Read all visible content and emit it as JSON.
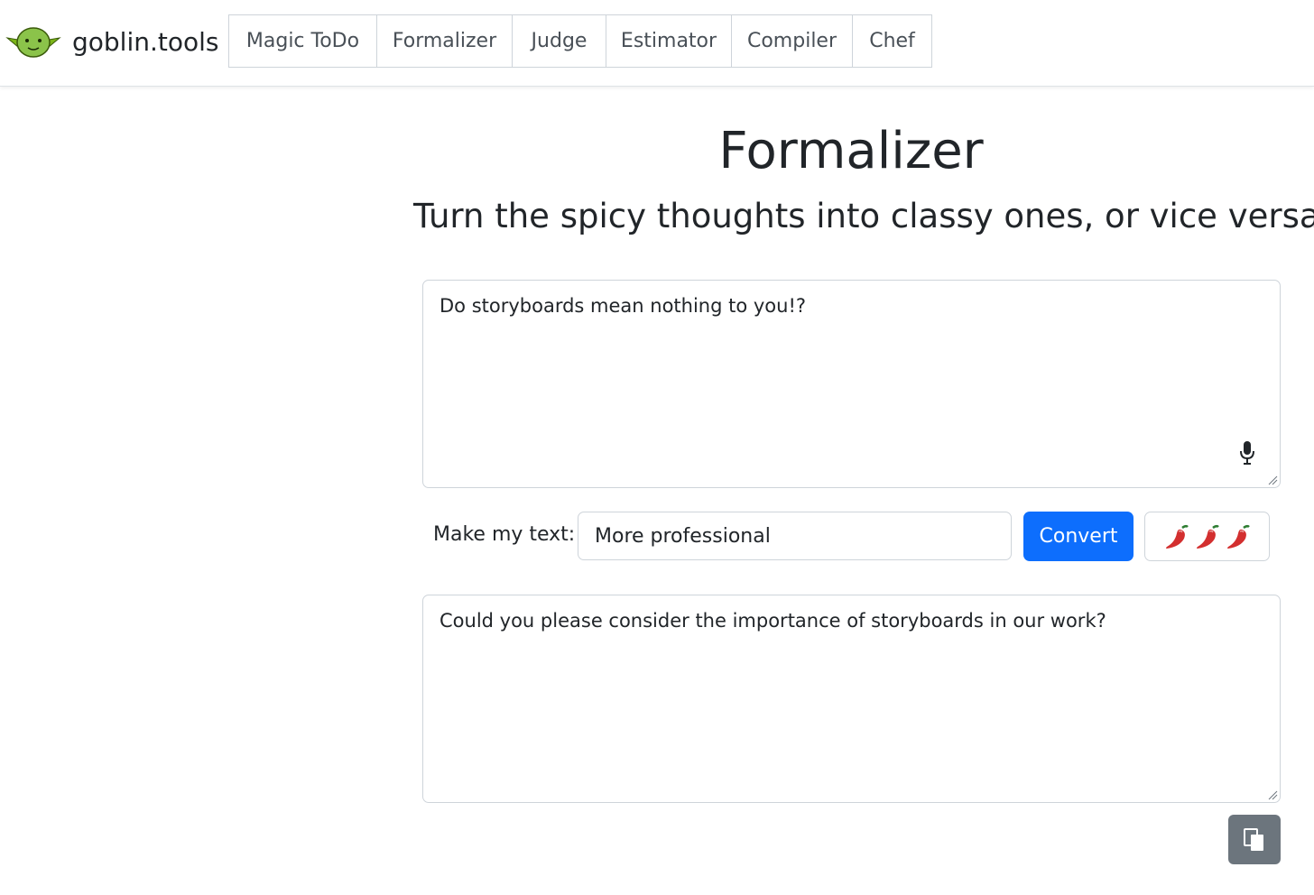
{
  "brand": {
    "name": "goblin.tools",
    "logo_icon": "goblin-face-icon"
  },
  "nav": {
    "items": [
      {
        "label": "Magic ToDo"
      },
      {
        "label": "Formalizer"
      },
      {
        "label": "Judge"
      },
      {
        "label": "Estimator"
      },
      {
        "label": "Compiler"
      },
      {
        "label": "Chef"
      }
    ]
  },
  "main": {
    "title": "Formalizer",
    "subtitle": "Turn the spicy thoughts into classy ones, or vice versa",
    "input_text": "Do storyboards mean nothing to you!?",
    "make_label": "Make my text:",
    "style_selected": "More professional",
    "convert_label": "Convert",
    "spiciness_icon": "chili-pepper-icon",
    "spiciness_level": 3,
    "output_text": "Could you please consider the importance of storyboards in our work?"
  },
  "colors": {
    "accent": "#0d6efd",
    "secondary": "#6c757d",
    "goblin_green": "#8bc34a"
  }
}
